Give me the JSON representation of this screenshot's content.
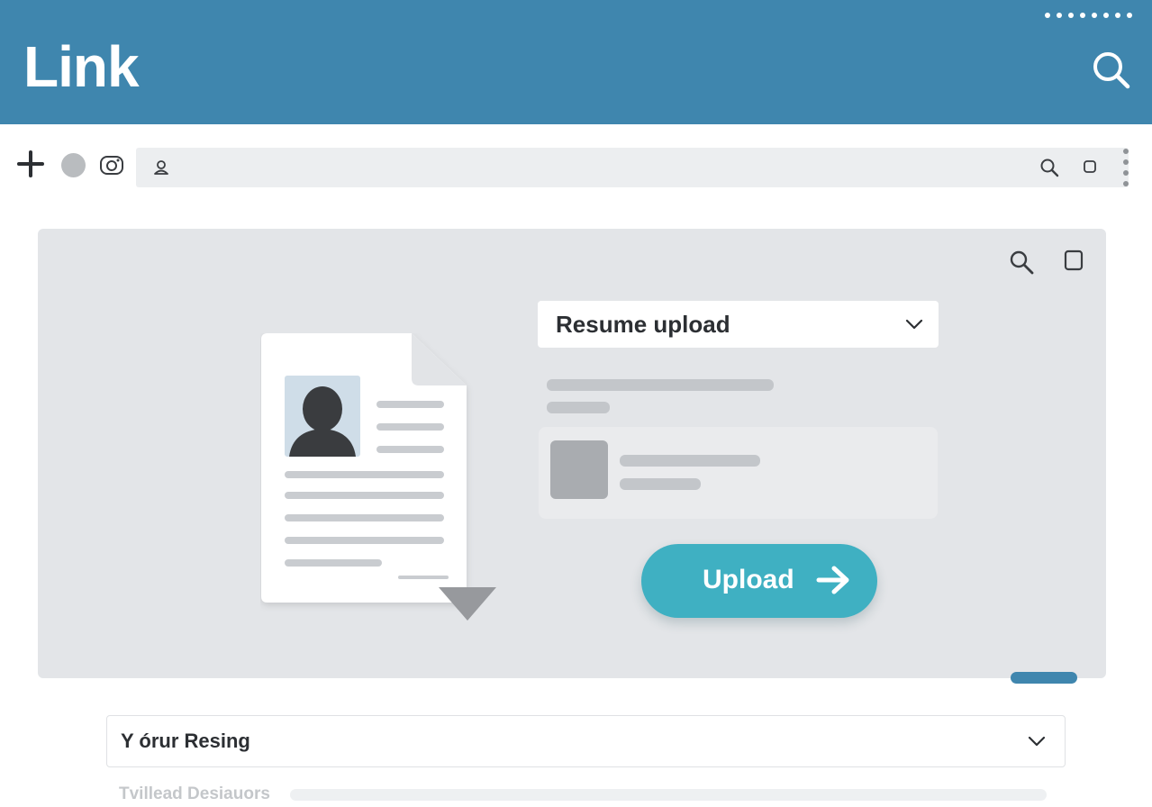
{
  "header": {
    "brand": "Link",
    "search_icon": "search-icon",
    "menu_icon": "dots-menu-icon"
  },
  "toolbar": {
    "icons": [
      "plus-icon",
      "status-dot",
      "camera-icon"
    ],
    "address_bar": {
      "value": "",
      "left_icon": "user-icon",
      "right_icons": [
        "search-icon",
        "square-icon",
        "kebab-icon"
      ]
    }
  },
  "panel": {
    "icons": [
      "search-icon",
      "square-icon"
    ],
    "select": {
      "value": "Resume upload"
    },
    "upload_button": {
      "label": "Upload"
    }
  },
  "bottom": {
    "select": {
      "value": "Y órur Resing"
    },
    "field_label": "Tvillead Desiauors"
  },
  "colors": {
    "header": "#3f86ae",
    "upload_button": "#3fb0c2",
    "panel": "#e3e5e8"
  }
}
